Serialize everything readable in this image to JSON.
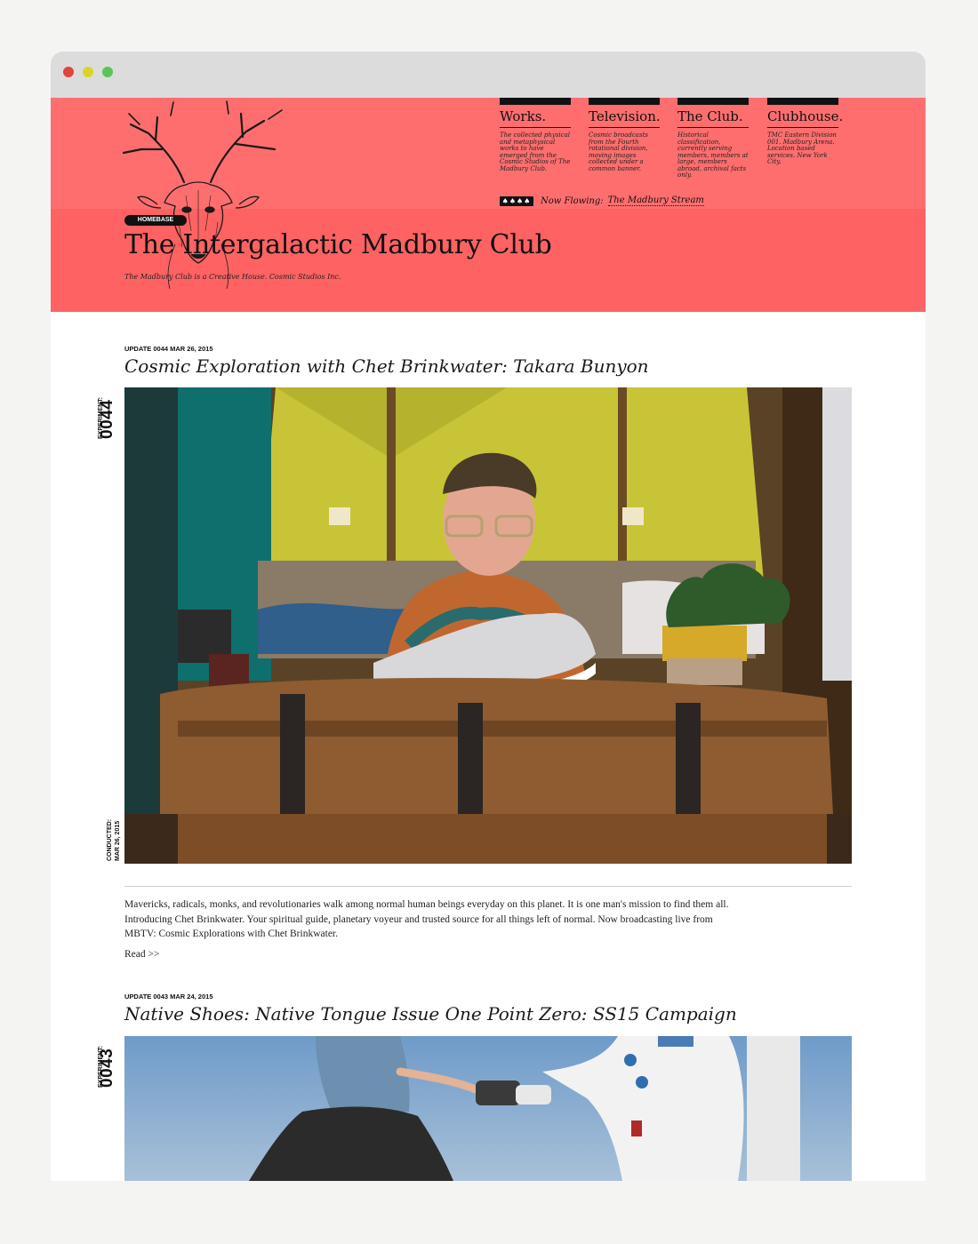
{
  "nav": [
    {
      "title": "Works.",
      "desc": "The collected physical and metaphysical works to have emerged from the Cosmic Studios of The Madbury Club."
    },
    {
      "title": "Television.",
      "desc": "Cosmic broadcasts from the Fourth rotational division, moving images collected under a common banner."
    },
    {
      "title": "The Club.",
      "desc": "Historical classification, currently serving members, members at large, members abroad, archival facts only."
    },
    {
      "title": "Clubhouse.",
      "desc": "TMC Eastern Division 001. Madbury Arena. Location based services. New York City."
    }
  ],
  "now_flowing": {
    "label": "Now Flowing:",
    "link": "The Madbury Stream",
    "icon": "cards-icon"
  },
  "homebase_badge": "HOMEBASE",
  "site_title": "The Intergalactic Madbury Club",
  "tagline": "The Madbury Club is a Creative House. Cosmic Studios Inc.",
  "posts": [
    {
      "meta": "UPDATE 0044  MAR 26, 2015",
      "title": "Cosmic Exploration with Chet Brinkwater: Takara Bunyon",
      "experiment_label": "EXPERIMENT:",
      "experiment_number": "0044",
      "conducted_label": "CONDUCTED:",
      "conducted_date": "MAR 26, 2015",
      "excerpt": "Mavericks, radicals, monks, and revolutionaries walk among normal human beings everyday on this planet. It is one man's mission to find them all. Introducing Chet Brinkwater. Your spiritual guide, planetary voyeur and trusted source for all things left of normal. Now broadcasting live from MBTV: Cosmic Explorations with Chet Brinkwater.",
      "read_more": "Read >>"
    },
    {
      "meta": "UPDATE 0043  MAR 24, 2015",
      "title": "Native Shoes: Native Tongue Issue One Point Zero: SS15 Campaign",
      "experiment_label": "EXPERIMENT:",
      "experiment_number": "0043"
    }
  ],
  "colors": {
    "header_pink": "#ff6e6e",
    "header_band": "#ff6262",
    "ink": "#111111"
  }
}
